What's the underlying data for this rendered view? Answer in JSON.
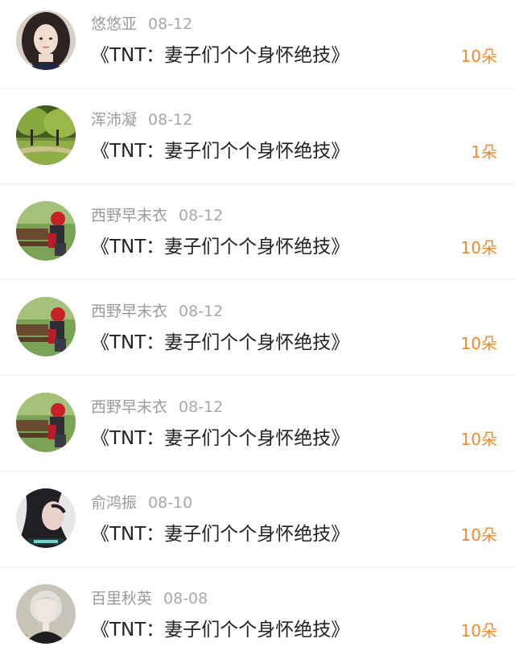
{
  "colors": {
    "accent_count": "#f08a2a",
    "meta_text": "#9a9a9a",
    "title_text": "#222222",
    "divider": "#f0f0f0"
  },
  "rows": [
    {
      "user": "悠悠亚",
      "date": "08-12",
      "title": "《TNT：妻子们个个身怀绝技》",
      "count": "10朵",
      "avatar": "girl-portrait-avatar"
    },
    {
      "user": "浑沛凝",
      "date": "08-12",
      "title": "《TNT：妻子们个个身怀绝技》",
      "count": "1朵",
      "avatar": "green-tree-avatar"
    },
    {
      "user": "西野早末衣",
      "date": "08-12",
      "title": "《TNT：妻子们个个身怀绝技》",
      "count": "10朵",
      "avatar": "girl-on-bench-avatar"
    },
    {
      "user": "西野早末衣",
      "date": "08-12",
      "title": "《TNT：妻子们个个身怀绝技》",
      "count": "10朵",
      "avatar": "girl-on-bench-avatar"
    },
    {
      "user": "西野早末衣",
      "date": "08-12",
      "title": "《TNT：妻子们个个身怀绝技》",
      "count": "10朵",
      "avatar": "girl-on-bench-avatar"
    },
    {
      "user": "俞鸿振",
      "date": "08-10",
      "title": "《TNT：妻子们个个身怀绝技》",
      "count": "10朵",
      "avatar": "dark-hair-girl-avatar"
    },
    {
      "user": "百里秋英",
      "date": "08-08",
      "title": "《TNT：妻子们个个身怀绝技》",
      "count": "10朵",
      "avatar": "anime-boy-avatar"
    }
  ]
}
